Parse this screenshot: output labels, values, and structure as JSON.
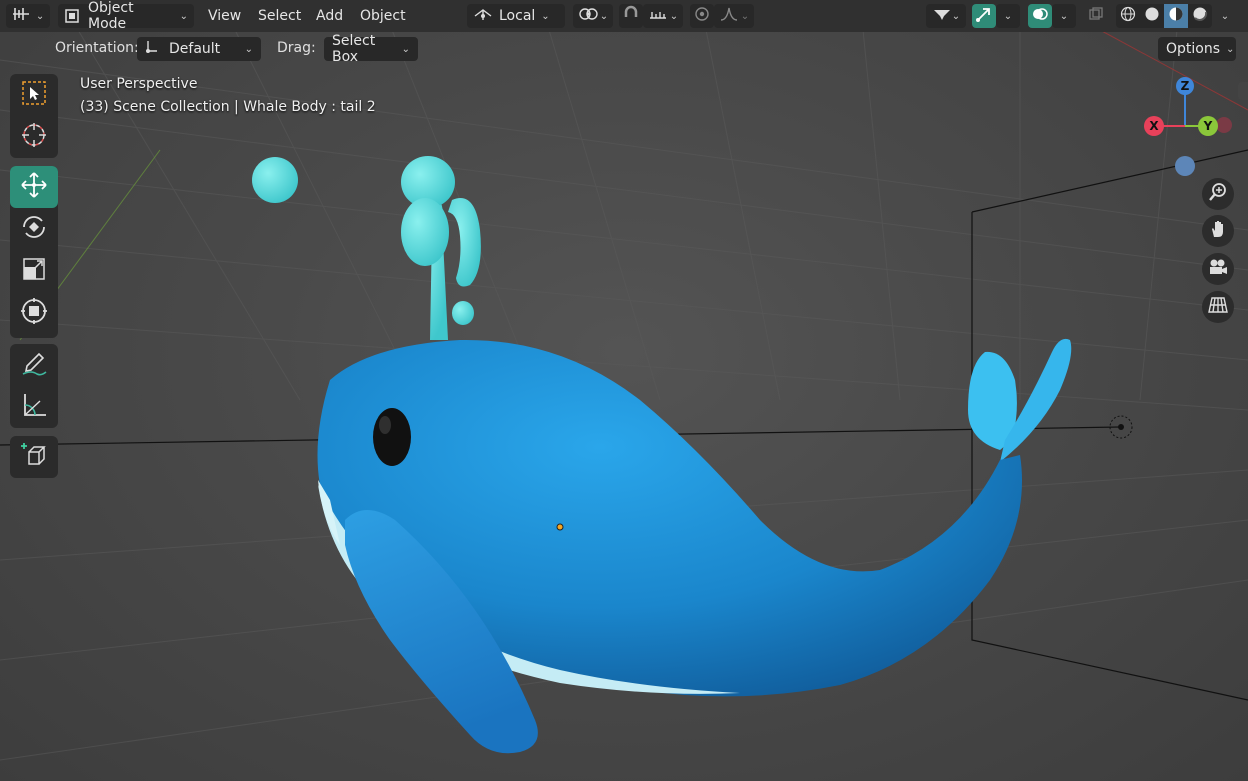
{
  "header": {
    "editor_type_icon": "viewport-editor-icon",
    "mode": {
      "label": "Object Mode",
      "icon": "object-mode-icon"
    },
    "menus": [
      "View",
      "Select",
      "Add",
      "Object"
    ],
    "transform_orientation": {
      "label": "Local",
      "icon": "orientation-icon"
    },
    "pivot_icon": "pivot-icon",
    "snap_icon": "snap-magnet-icon",
    "snap_target_icon": "snap-increment-icon",
    "proportional_icon": "proportional-edit-icon",
    "falloff_icon": "falloff-curve-icon",
    "visibility_icon": "visibility-icon",
    "gizmo_icon": "gizmo-icon",
    "overlay_icon": "overlay-icon",
    "xray_icon": "xray-icon",
    "shading_modes": [
      "wireframe-icon",
      "solid-icon",
      "material-preview-icon",
      "rendered-icon"
    ],
    "active_shading": "material-preview-icon"
  },
  "tool_settings": {
    "orientation_label": "Orientation:",
    "orientation_value": "Default",
    "drag_label": "Drag:",
    "drag_value": "Select Box",
    "options_label": "Options"
  },
  "viewport": {
    "perspective_label": "User Perspective",
    "collection_label": "(33) Scene Collection | Whale Body : tail 2"
  },
  "toolbar": {
    "groups": [
      [
        "select-box-icon",
        "cursor-icon"
      ],
      [
        "move-icon",
        "rotate-icon",
        "scale-icon",
        "transform-icon"
      ],
      [
        "annotate-icon",
        "measure-icon"
      ],
      [
        "add-cube-icon"
      ]
    ],
    "active_tool": "move-icon"
  },
  "navigation_gizmo": {
    "axes": {
      "z": "Z",
      "x": "X",
      "y": "Y"
    },
    "colors": {
      "x": "#e8415a",
      "y": "#8bc73a",
      "z": "#3f86d9",
      "neg": "#5d86b8"
    }
  },
  "nav_buttons": [
    "zoom-icon",
    "pan-hand-icon",
    "camera-view-icon",
    "ortho-grid-icon"
  ],
  "colors": {
    "header_bg": "#303030",
    "active_tool": "#2d8f79",
    "whale_body": "#1c8fd6",
    "whale_belly": "#bfe8f2",
    "water_spout": "#53d6d6"
  }
}
